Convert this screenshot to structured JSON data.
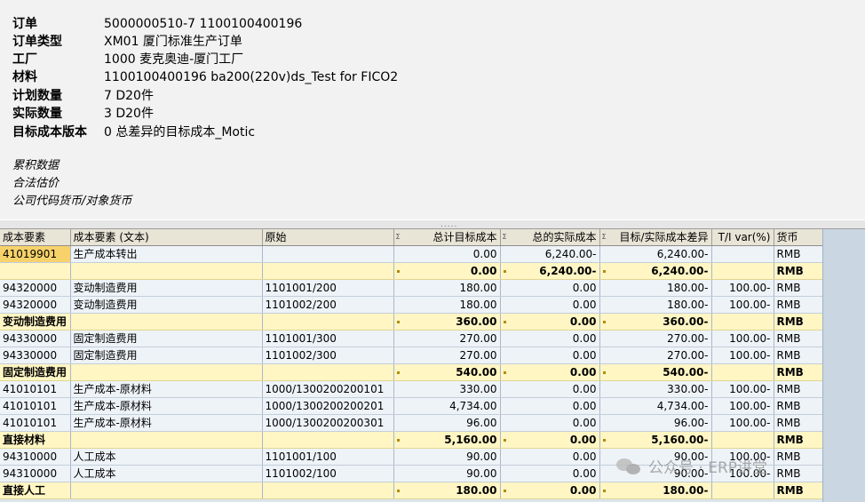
{
  "header": {
    "fields": [
      {
        "label": "订单",
        "value": "5000000510-7 1100100400196"
      },
      {
        "label": "订单类型",
        "value": "XM01 厦门标准生产订单"
      },
      {
        "label": "工厂",
        "value": "1000 麦克奥迪-厦门工厂"
      },
      {
        "label": "材料",
        "value": "1100100400196 ba200(220v)ds_Test for FICO2"
      },
      {
        "label": "计划数量",
        "value": "7 D20件"
      },
      {
        "label": "实际数量",
        "value": "3 D20件"
      },
      {
        "label": "目标成本版本",
        "value": "0 总差异的目标成本_Motic"
      }
    ],
    "links": [
      "累积数据",
      "合法估价",
      "公司代码货币/对象货币"
    ]
  },
  "table": {
    "columns": [
      "成本要素",
      "成本要素 (文本)",
      "原始",
      "总计目标成本",
      "总的实际成本",
      "目标/实际成本差异",
      "T/I var(%)",
      "货币"
    ],
    "rows": [
      {
        "type": "data",
        "cells": [
          "41019901",
          "生产成本转出",
          "",
          "0.00",
          "6,240.00-",
          "6,240.00-",
          "",
          "RMB"
        ]
      },
      {
        "type": "sub",
        "cells": [
          "",
          "",
          "",
          "0.00",
          "6,240.00-",
          "6,240.00-",
          "",
          "RMB"
        ]
      },
      {
        "type": "data",
        "cells": [
          "94320000",
          "变动制造费用",
          "1101001/200",
          "180.00",
          "0.00",
          "180.00-",
          "100.00-",
          "RMB"
        ]
      },
      {
        "type": "data",
        "cells": [
          "94320000",
          "变动制造费用",
          "1101002/200",
          "180.00",
          "0.00",
          "180.00-",
          "100.00-",
          "RMB"
        ]
      },
      {
        "type": "sub",
        "cells": [
          "变动制造费用",
          "",
          "",
          "360.00",
          "0.00",
          "360.00-",
          "",
          "RMB"
        ]
      },
      {
        "type": "data",
        "cells": [
          "94330000",
          "固定制造费用",
          "1101001/300",
          "270.00",
          "0.00",
          "270.00-",
          "100.00-",
          "RMB"
        ]
      },
      {
        "type": "data",
        "cells": [
          "94330000",
          "固定制造费用",
          "1101002/300",
          "270.00",
          "0.00",
          "270.00-",
          "100.00-",
          "RMB"
        ]
      },
      {
        "type": "sub",
        "cells": [
          "固定制造费用",
          "",
          "",
          "540.00",
          "0.00",
          "540.00-",
          "",
          "RMB"
        ]
      },
      {
        "type": "data",
        "cells": [
          "41010101",
          "生产成本-原材料",
          "1000/1300200200101",
          "330.00",
          "0.00",
          "330.00-",
          "100.00-",
          "RMB"
        ]
      },
      {
        "type": "data",
        "cells": [
          "41010101",
          "生产成本-原材料",
          "1000/1300200200201",
          "4,734.00",
          "0.00",
          "4,734.00-",
          "100.00-",
          "RMB"
        ]
      },
      {
        "type": "data",
        "cells": [
          "41010101",
          "生产成本-原材料",
          "1000/1300200200301",
          "96.00",
          "0.00",
          "96.00-",
          "100.00-",
          "RMB"
        ]
      },
      {
        "type": "sub",
        "cells": [
          "直接材料",
          "",
          "",
          "5,160.00",
          "0.00",
          "5,160.00-",
          "",
          "RMB"
        ]
      },
      {
        "type": "data",
        "cells": [
          "94310000",
          "人工成本",
          "1101001/100",
          "90.00",
          "0.00",
          "90.00-",
          "100.00-",
          "RMB"
        ]
      },
      {
        "type": "data",
        "cells": [
          "94310000",
          "人工成本",
          "1101002/100",
          "90.00",
          "0.00",
          "90.00-",
          "100.00-",
          "RMB"
        ]
      },
      {
        "type": "sub",
        "cells": [
          "直接人工",
          "",
          "",
          "180.00",
          "0.00",
          "180.00-",
          "",
          "RMB"
        ]
      }
    ]
  },
  "watermark": {
    "text": "公众号 · ERP讲堂"
  },
  "colors": {
    "subtotal_bg": "#fff6c4",
    "header_bg": "#e8e4d6",
    "selected_cell": "#f7d26a",
    "row_bg": "#eef3f8"
  }
}
